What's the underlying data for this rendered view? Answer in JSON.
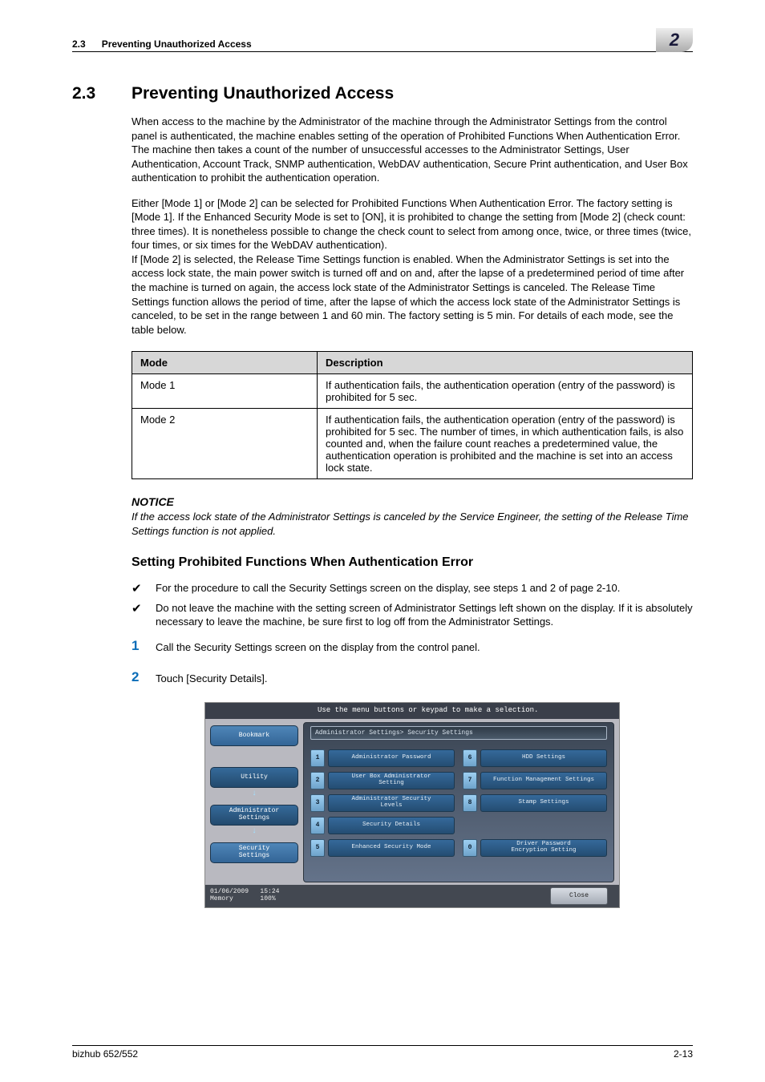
{
  "header": {
    "section_ref": "2.3",
    "section_name": "Preventing Unauthorized Access",
    "chapter_badge": "2"
  },
  "title": {
    "number": "2.3",
    "text": "Preventing Unauthorized Access"
  },
  "paragraphs": {
    "p1": "When access to the machine by the Administrator of the machine through the Administrator Settings from the control panel is authenticated, the machine enables setting of the operation of Prohibited Functions When Authentication Error. The machine then takes a count of the number of unsuccessful accesses to the Administrator Settings, User Authentication, Account Track, SNMP authentication, WebDAV authentication, Secure Print authentication, and User Box authentication to prohibit the authentication operation.",
    "p2": "Either [Mode 1] or [Mode 2] can be selected for Prohibited Functions When Authentication Error. The factory setting is [Mode 1]. If the Enhanced Security Mode is set to [ON], it is prohibited to change the setting from [Mode 2] (check count: three times). It is nonetheless possible to change the check count to select from among once, twice, or three times (twice, four times, or six times for the WebDAV authentication).\nIf [Mode 2] is selected, the Release Time Settings function is enabled. When the Administrator Settings is set into the access lock state, the main power switch is turned off and on and, after the lapse of a predetermined period of time after the machine is turned on again, the access lock state of the Administrator Settings is canceled. The Release Time Settings function allows the period of time, after the lapse of which the access lock state of the Administrator Settings is canceled, to be set in the range between 1 and 60 min. The factory setting is 5 min. For details of each mode, see the table below."
  },
  "table": {
    "head_mode": "Mode",
    "head_desc": "Description",
    "rows": [
      {
        "mode": "Mode 1",
        "desc": "If authentication fails, the authentication operation (entry of the password) is prohibited for 5 sec."
      },
      {
        "mode": "Mode 2",
        "desc": "If authentication fails, the authentication operation (entry of the password) is prohibited for 5 sec. The number of times, in which authentication fails, is also counted and, when the failure count reaches a predetermined value, the authentication operation is prohibited and the machine is set into an access lock state."
      }
    ]
  },
  "notice": {
    "head": "NOTICE",
    "body": "If the access lock state of the Administrator Settings is canceled by the Service Engineer, the setting of the Release Time Settings function is not applied."
  },
  "subheading": "Setting Prohibited Functions When Authentication Error",
  "checks": {
    "c1": "For the procedure to call the Security Settings screen on the display, see steps 1 and 2 of page 2-10.",
    "c2": "Do not leave the machine with the setting screen of Administrator Settings left shown on the display. If it is absolutely necessary to leave the machine, be sure first to log off from the Administrator Settings."
  },
  "steps": {
    "n1": "1",
    "t1": "Call the Security Settings screen on the display from the control panel.",
    "n2": "2",
    "t2": "Touch [Security Details]."
  },
  "screenshot": {
    "instruction": "Use the menu buttons or keypad to make a selection.",
    "breadcrumb": "Administrator Settings> Security Settings",
    "sidebar": {
      "bookmark": "Bookmark",
      "utility": "Utility",
      "admin": "Administrator\nSettings",
      "security": "Security\nSettings"
    },
    "items": {
      "i1": "Administrator Password",
      "i2": "User Box Administrator\nSetting",
      "i3": "Administrator Security\nLevels",
      "i4": "Security Details",
      "i5": "Enhanced Security Mode",
      "i6": "HDD Settings",
      "i7": "Function Management Settings",
      "i8": "Stamp Settings",
      "i0": "Driver Password\nEncryption Setting"
    },
    "nums": {
      "n1": "1",
      "n2": "2",
      "n3": "3",
      "n4": "4",
      "n5": "5",
      "n6": "6",
      "n7": "7",
      "n8": "8",
      "n0": "0"
    },
    "timestamp": "01/06/2009   15:24\nMemory       100%",
    "close": "Close"
  },
  "footer": {
    "product": "bizhub 652/552",
    "page": "2-13"
  }
}
